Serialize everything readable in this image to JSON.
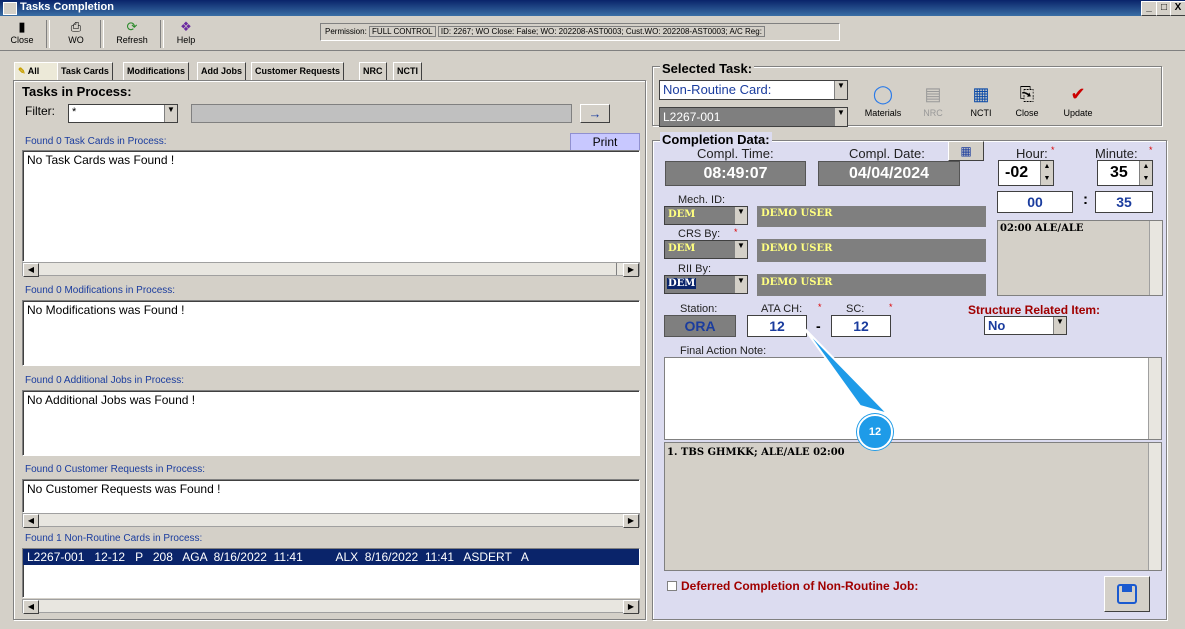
{
  "window": {
    "title": "Tasks Completion",
    "controls": [
      "_",
      "□",
      "X"
    ]
  },
  "toolbar": {
    "close": "Close",
    "wo": "WO",
    "refresh": "Refresh",
    "help": "Help",
    "permission_label": "Permission:",
    "permission_value": "FULL CONTROL",
    "info": "ID: 2267; WO Close: False; WO: 202208-AST0003; Cust.WO: 202208-AST0003; A/C Reg:"
  },
  "tabs": [
    "All",
    "Task Cards",
    "Modifications",
    "Add Jobs",
    "Customer Requests",
    "NRC",
    "NCTI"
  ],
  "left": {
    "title": "Tasks in Process:",
    "filter_label": "Filter:",
    "filter_value": "*",
    "print": "Print",
    "arrow": "→",
    "task_cards_label": "Found 0 Task Cards in Process:",
    "task_cards_text": "No Task Cards was Found !",
    "mods_label": "Found 0 Modifications in Process:",
    "mods_text": "No Modifications was Found !",
    "addjobs_label": "Found 0 Additional Jobs in Process:",
    "addjobs_text": "No Additional Jobs was Found !",
    "custreq_label": "Found 0 Customer Requests in Process:",
    "custreq_text": "No Customer Requests was Found !",
    "nrc_label": "Found 1 Non-Routine Cards in Process:",
    "nrc_row": "L2267-001   12-12   P   208   AGA  8/16/2022  11:41          ALX  8/16/2022  11:41   ASDERT   A"
  },
  "selected": {
    "title": "Selected Task:",
    "type_value": "Non-Routine Card:",
    "task_value": "L2267-001",
    "buttons": {
      "materials": "Materials",
      "nrc": "NRC",
      "ncti": "NCTI",
      "close": "Close",
      "update": "Update"
    }
  },
  "completion": {
    "title": "Completion Data:",
    "time_label": "Compl. Time:",
    "time_value": "08:49:07",
    "date_label": "Compl. Date:",
    "date_value": "04/04/2024",
    "hour_label": "Hour:",
    "hour_value": "-02",
    "minute_label": "Minute:",
    "minute_value": "35",
    "total_hours": "00",
    "colon": ":",
    "total_minutes": "35",
    "time_list_item": "02:00  ALE/ALE",
    "mech_label": "Mech. ID:",
    "mech_code": "DEM",
    "mech_name": "DEMO USER",
    "crs_label": "CRS By:",
    "crs_code": "DEM",
    "crs_name": "DEMO USER",
    "rii_label": "RII By:",
    "rii_code": "DEM",
    "rii_name": "DEMO USER",
    "station_label": "Station:",
    "station_value": "ORA",
    "ata_label": "ATA CH:",
    "ata_value": "12",
    "dash": "-",
    "sc_label": "SC:",
    "sc_value": "12",
    "structure_label": "Structure Related Item:",
    "structure_value": "No",
    "final_note_label": "Final Action Note:",
    "history_item": "1. TBS GHMKK; ALE/ALE  02:00",
    "deferred_label": "Deferred Completion of Non-Routine Job:",
    "callout": "12",
    "star": "*"
  },
  "colors": {
    "accent_blue": "#1a3c9e",
    "callout": "#1e9be8",
    "selection": "#0a246a"
  }
}
